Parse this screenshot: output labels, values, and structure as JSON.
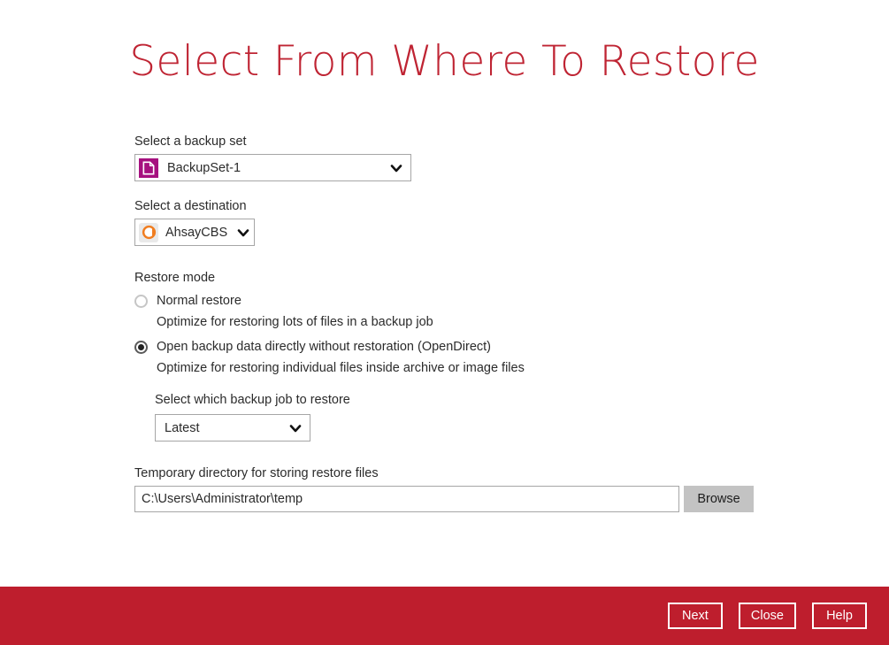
{
  "page": {
    "title": "Select From Where To Restore"
  },
  "backup_set": {
    "label": "Select a backup set",
    "value": "BackupSet-1",
    "icon": "document-icon",
    "icon_color": "#a6117f",
    "chevron": "chevron-down-icon"
  },
  "destination": {
    "label": "Select a destination",
    "value": "AhsayCBS",
    "icon": "ahsaycbs-logo-icon",
    "icon_color": "#f07d20",
    "chevron": "chevron-down-icon"
  },
  "restore_mode": {
    "label": "Restore mode",
    "options": [
      {
        "label": "Normal restore",
        "description": "Optimize for restoring lots of files in a backup job",
        "selected": false
      },
      {
        "label": "Open backup data directly without restoration (OpenDirect)",
        "description": "Optimize for restoring individual files inside archive or image files",
        "selected": true
      }
    ]
  },
  "backup_job": {
    "label": "Select which backup job to restore",
    "value": "Latest",
    "chevron": "chevron-down-icon"
  },
  "temp_directory": {
    "label": "Temporary directory for storing restore files",
    "value": "C:\\Users\\Administrator\\temp",
    "browse_label": "Browse"
  },
  "footer": {
    "background": "#be1e2d",
    "buttons": [
      {
        "label": "Next"
      },
      {
        "label": "Close"
      },
      {
        "label": "Help"
      }
    ]
  }
}
